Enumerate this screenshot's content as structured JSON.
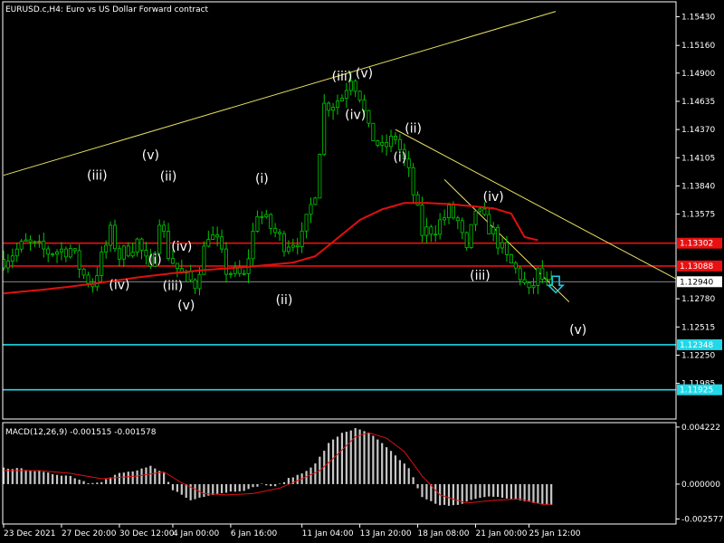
{
  "window": {
    "title": "EURUSD.c,H4:  Euro vs US Dollar Forward contract",
    "macd_label": "MACD(12,26,9) -0.001515 -0.001578"
  },
  "colors": {
    "background": "#000000",
    "axis": "#ffffff",
    "candle": "#00c800",
    "ma_line": "#e01010",
    "hline_red": "#e81010",
    "hline_cyan": "#20d8e8",
    "hline_grey": "#9a9a9a",
    "trendline": "#e8e060",
    "macd_hist": "#c8c8c8",
    "macd_signal": "#e01010",
    "wave_label": "#ffffff",
    "arrow": "#20c8e0"
  },
  "chart_data": {
    "type": "candlestick",
    "symbol": "EURUSD.c",
    "timeframe": "H4",
    "ylim": [
      1.1165,
      1.1557
    ],
    "price_ticks": [
      "1.15430",
      "1.15160",
      "1.14900",
      "1.14635",
      "1.14370",
      "1.14105",
      "1.13840",
      "1.13575",
      "1.12780",
      "1.12515",
      "1.12250",
      "1.11985"
    ],
    "price_ticks_values": [
      1.1543,
      1.1516,
      1.149,
      1.14635,
      1.1437,
      1.14105,
      1.1384,
      1.13575,
      1.1278,
      1.12515,
      1.1225,
      1.11985
    ],
    "time_labels": [
      "23 Dec 2021",
      "27 Dec 20:00",
      "30 Dec 12:00",
      "4 Jan 00:00",
      "6 Jan 16:00",
      "11 Jan 04:00",
      "13 Jan 20:00",
      "18 Jan 08:00",
      "21 Jan 00:00",
      "25 Jan 12:00"
    ],
    "time_label_index": [
      0,
      13,
      26,
      38,
      51,
      67,
      80,
      93,
      106,
      118
    ],
    "n_bars": 124,
    "anchor_closes": [
      [
        0,
        1.1315
      ],
      [
        5,
        1.133
      ],
      [
        10,
        1.1322
      ],
      [
        15,
        1.1325
      ],
      [
        18,
        1.13
      ],
      [
        20,
        1.1292
      ],
      [
        24,
        1.134
      ],
      [
        26,
        1.1318
      ],
      [
        30,
        1.1332
      ],
      [
        33,
        1.1302
      ],
      [
        35,
        1.1355
      ],
      [
        37,
        1.132
      ],
      [
        40,
        1.13
      ],
      [
        43,
        1.1292
      ],
      [
        46,
        1.134
      ],
      [
        48,
        1.133
      ],
      [
        50,
        1.1305
      ],
      [
        54,
        1.1298
      ],
      [
        57,
        1.136
      ],
      [
        59,
        1.135
      ],
      [
        63,
        1.133
      ],
      [
        67,
        1.1335
      ],
      [
        70,
        1.138
      ],
      [
        72,
        1.146
      ],
      [
        74,
        1.1462
      ],
      [
        76,
        1.1468
      ],
      [
        78,
        1.1488
      ],
      [
        80,
        1.147
      ],
      [
        82,
        1.1435
      ],
      [
        85,
        1.1418
      ],
      [
        88,
        1.143
      ],
      [
        91,
        1.1395
      ],
      [
        94,
        1.134
      ],
      [
        97,
        1.1345
      ],
      [
        100,
        1.136
      ],
      [
        102,
        1.135
      ],
      [
        104,
        1.132
      ],
      [
        106,
        1.1362
      ],
      [
        108,
        1.135
      ],
      [
        110,
        1.134
      ],
      [
        113,
        1.1315
      ],
      [
        116,
        1.13
      ],
      [
        118,
        1.1282
      ],
      [
        120,
        1.1302
      ],
      [
        123,
        1.1285
      ]
    ],
    "moving_average": [
      [
        0,
        1.1283
      ],
      [
        10,
        1.1287
      ],
      [
        20,
        1.1292
      ],
      [
        30,
        1.1298
      ],
      [
        38,
        1.1302
      ],
      [
        45,
        1.1305
      ],
      [
        55,
        1.1308
      ],
      [
        65,
        1.1312
      ],
      [
        70,
        1.1318
      ],
      [
        75,
        1.1335
      ],
      [
        80,
        1.1352
      ],
      [
        85,
        1.1362
      ],
      [
        90,
        1.1368
      ],
      [
        95,
        1.1368
      ],
      [
        100,
        1.1367
      ],
      [
        105,
        1.1365
      ],
      [
        110,
        1.1363
      ],
      [
        114,
        1.1358
      ],
      [
        117,
        1.1336
      ],
      [
        120,
        1.1333
      ]
    ],
    "horizontal_lines": [
      {
        "value": 1.13302,
        "label": "1.13302",
        "color": "red"
      },
      {
        "value": 1.13088,
        "label": "1.13088",
        "color": "red"
      },
      {
        "value": 1.1294,
        "label": "1.12940",
        "color": "grey"
      },
      {
        "value": 1.12348,
        "label": "1.12348",
        "color": "cyan"
      },
      {
        "value": 1.11925,
        "label": "1.11925",
        "color": "cyan"
      }
    ],
    "trendlines": [
      {
        "from": [
          0,
          1.1394
        ],
        "to": [
          124,
          1.1548
        ]
      },
      {
        "from": [
          88,
          1.1437
        ],
        "to": [
          154,
          1.129
        ]
      },
      {
        "from": [
          99,
          1.139
        ],
        "to": [
          127,
          1.1275
        ]
      }
    ],
    "wave_labels": [
      {
        "text": "(iii)",
        "bar": 21,
        "price": 1.139
      },
      {
        "text": "(v)",
        "bar": 33,
        "price": 1.1409
      },
      {
        "text": "(ii)",
        "bar": 37,
        "price": 1.1389
      },
      {
        "text": "(iv)",
        "bar": 26,
        "price": 1.1287
      },
      {
        "text": "(i)",
        "bar": 34,
        "price": 1.1311
      },
      {
        "text": "(iv)",
        "bar": 40,
        "price": 1.1323
      },
      {
        "text": "(iii)",
        "bar": 38,
        "price": 1.1286
      },
      {
        "text": "(v)",
        "bar": 41,
        "price": 1.1268
      },
      {
        "text": "(i)",
        "bar": 58,
        "price": 1.1387
      },
      {
        "text": "(ii)",
        "bar": 63,
        "price": 1.1273
      },
      {
        "text": "(iii)",
        "bar": 76,
        "price": 1.1483
      },
      {
        "text": "(v)",
        "bar": 81,
        "price": 1.1486
      },
      {
        "text": "(iv)",
        "bar": 79,
        "price": 1.1447
      },
      {
        "text": "(ii)",
        "bar": 92,
        "price": 1.1434
      },
      {
        "text": "(i)",
        "bar": 89,
        "price": 1.1407
      },
      {
        "text": "(iv)",
        "bar": 110,
        "price": 1.137
      },
      {
        "text": "(iii)",
        "bar": 107,
        "price": 1.1296
      },
      {
        "text": "(v)",
        "bar": 129,
        "price": 1.1245
      }
    ],
    "macd": {
      "label": "MACD(12,26,9) -0.001515 -0.001578",
      "ylim": [
        -0.00295,
        0.00455
      ],
      "ticks": [
        "0.004222",
        "0.000000",
        "-0.002577"
      ],
      "ticks_values": [
        0.004222,
        0.0,
        -0.002577
      ],
      "hist_anchors": [
        [
          0,
          0.0012
        ],
        [
          5,
          0.0011
        ],
        [
          10,
          0.0008
        ],
        [
          15,
          0.0006
        ],
        [
          19,
          0.0001
        ],
        [
          22,
          0.0002
        ],
        [
          26,
          0.0008
        ],
        [
          30,
          0.001
        ],
        [
          33,
          0.0013
        ],
        [
          36,
          0.0008
        ],
        [
          38,
          -0.0004
        ],
        [
          42,
          -0.0012
        ],
        [
          46,
          -0.0008
        ],
        [
          50,
          -0.0006
        ],
        [
          55,
          -0.0004
        ],
        [
          58,
          0.0
        ],
        [
          61,
          -0.0002
        ],
        [
          64,
          0.0004
        ],
        [
          67,
          0.0008
        ],
        [
          70,
          0.0015
        ],
        [
          73,
          0.003
        ],
        [
          76,
          0.0038
        ],
        [
          79,
          0.0041
        ],
        [
          82,
          0.0038
        ],
        [
          85,
          0.003
        ],
        [
          88,
          0.0021
        ],
        [
          91,
          0.0012
        ],
        [
          94,
          -0.001
        ],
        [
          98,
          -0.0016
        ],
        [
          102,
          -0.0015
        ],
        [
          106,
          -0.0011
        ],
        [
          110,
          -0.0009
        ],
        [
          114,
          -0.0011
        ],
        [
          118,
          -0.0013
        ],
        [
          121,
          -0.0015
        ]
      ],
      "signal_anchors": [
        [
          0,
          0.001
        ],
        [
          8,
          0.001
        ],
        [
          15,
          0.0008
        ],
        [
          22,
          0.0004
        ],
        [
          30,
          0.0006
        ],
        [
          36,
          0.0009
        ],
        [
          40,
          0.0001
        ],
        [
          45,
          -0.0007
        ],
        [
          50,
          -0.0008
        ],
        [
          56,
          -0.0007
        ],
        [
          62,
          -0.0003
        ],
        [
          67,
          0.0004
        ],
        [
          71,
          0.001
        ],
        [
          75,
          0.0022
        ],
        [
          79,
          0.0035
        ],
        [
          82,
          0.0038
        ],
        [
          86,
          0.0034
        ],
        [
          90,
          0.0024
        ],
        [
          94,
          0.0006
        ],
        [
          98,
          -0.0008
        ],
        [
          104,
          -0.0014
        ],
        [
          110,
          -0.0012
        ],
        [
          116,
          -0.0011
        ],
        [
          121,
          -0.0015
        ]
      ]
    }
  }
}
